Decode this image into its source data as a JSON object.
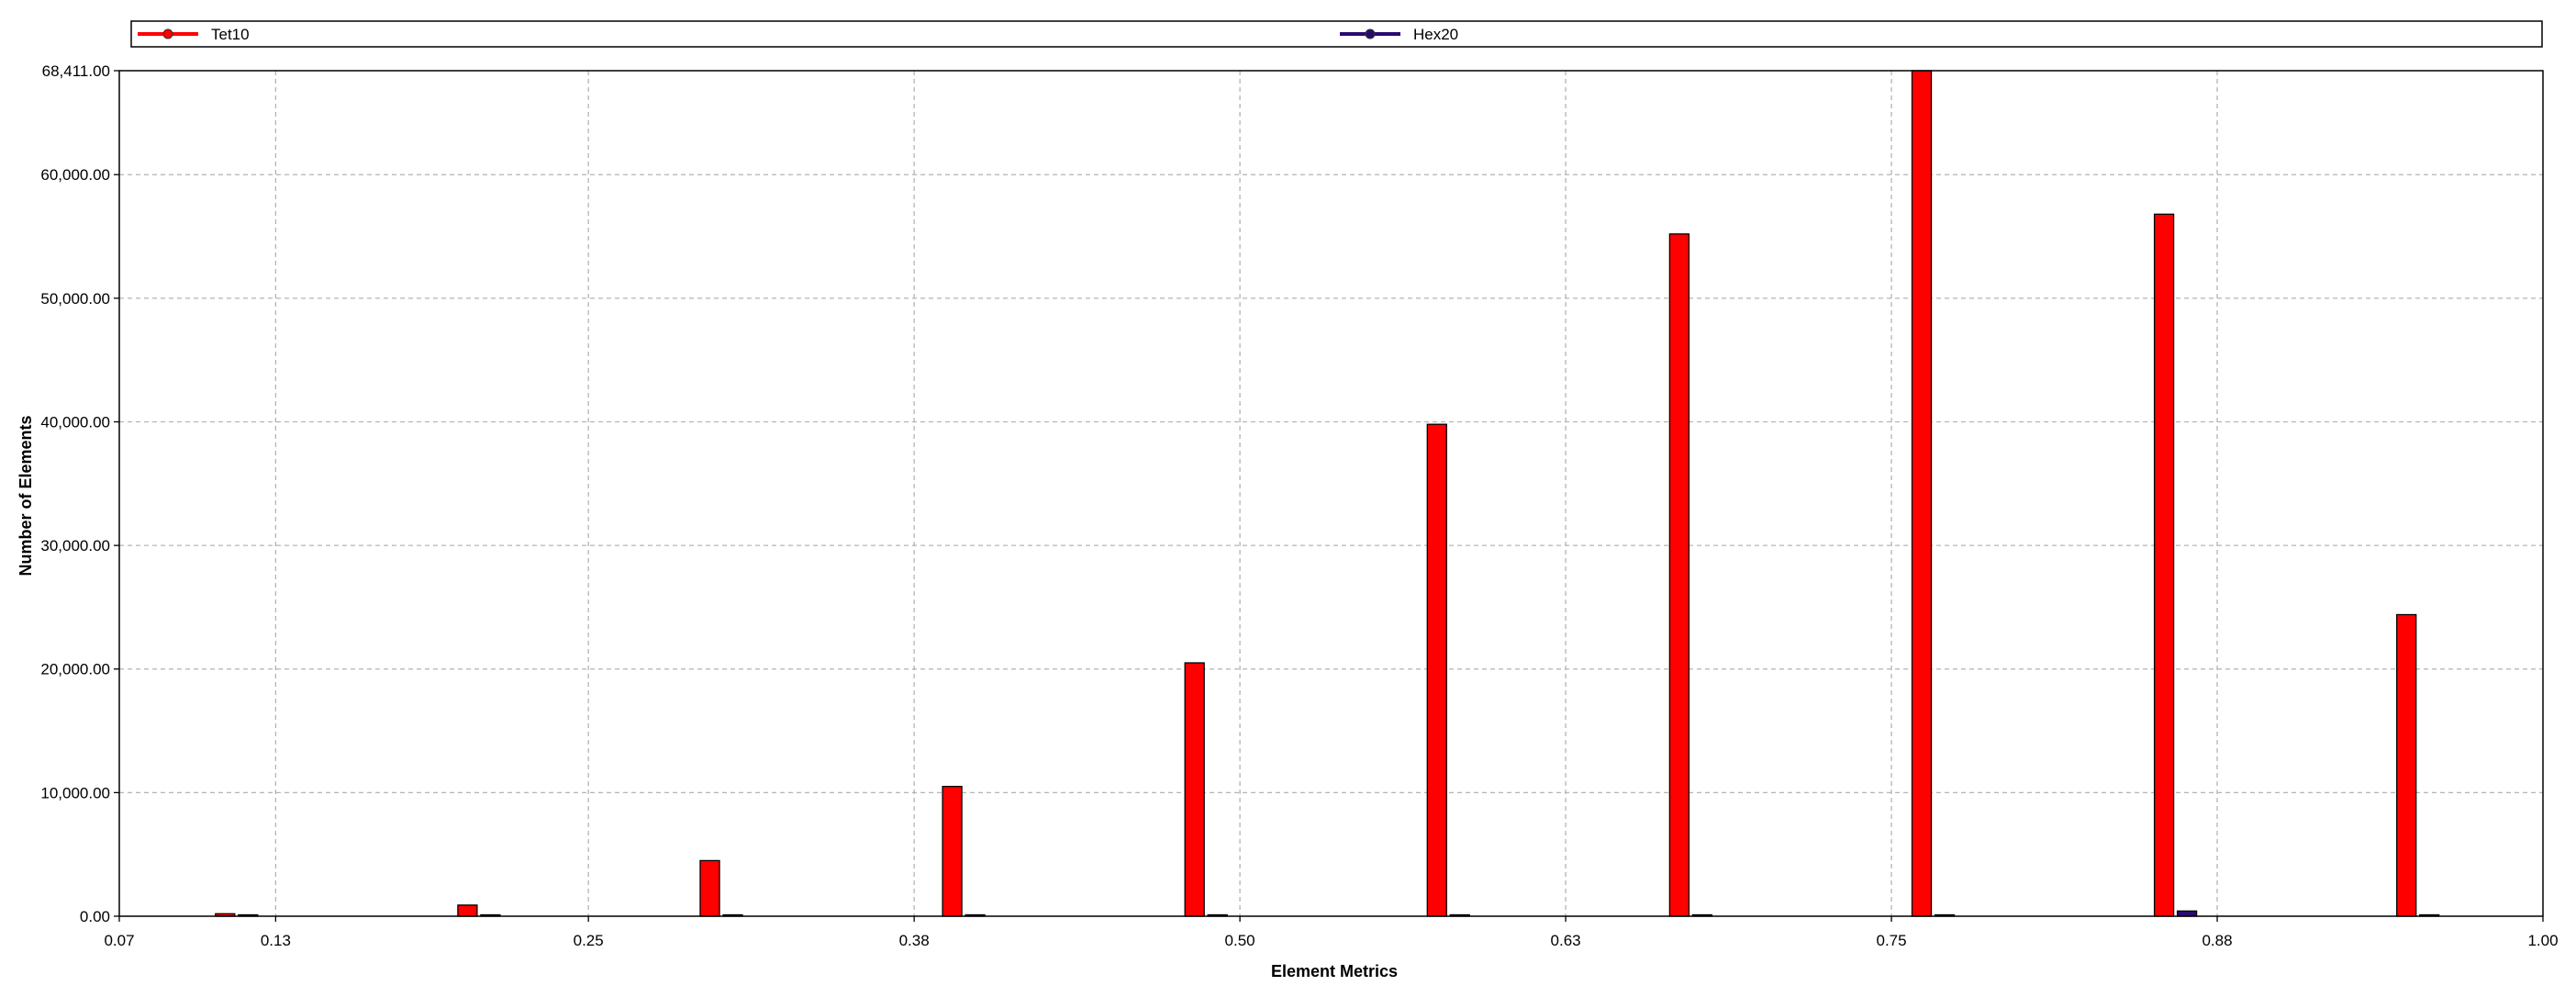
{
  "chart_data": {
    "type": "bar",
    "xlabel": "Element Metrics",
    "ylabel": "Number of Elements",
    "xlim": [
      0.07,
      1.0
    ],
    "ylim": [
      0,
      68411
    ],
    "x_ticks": [
      "0.07",
      "0.13",
      "0.25",
      "0.38",
      "0.50",
      "0.63",
      "0.75",
      "0.88",
      "1.00"
    ],
    "x_tick_values": [
      0.07,
      0.13,
      0.25,
      0.375,
      0.5,
      0.625,
      0.75,
      0.875,
      1.0
    ],
    "y_ticks": [
      "0.00",
      "10,000.00",
      "20,000.00",
      "30,000.00",
      "40,000.00",
      "50,000.00",
      "60,000.00",
      "68,411.00"
    ],
    "y_tick_values": [
      0,
      10000,
      20000,
      30000,
      40000,
      50000,
      60000,
      68411
    ],
    "grid": true,
    "legend_position": "top",
    "x": [
      0.115,
      0.208,
      0.301,
      0.394,
      0.487,
      0.58,
      0.673,
      0.766,
      0.859,
      0.952
    ],
    "series": [
      {
        "name": "Tet10",
        "color": "#ff0000",
        "values": [
          200,
          900,
          4500,
          10500,
          20500,
          39800,
          55200,
          68411,
          56800,
          24400
        ]
      },
      {
        "name": "Hex20",
        "color": "#2a0a6e",
        "values": [
          60,
          50,
          50,
          50,
          50,
          50,
          50,
          50,
          420,
          50
        ]
      }
    ]
  }
}
